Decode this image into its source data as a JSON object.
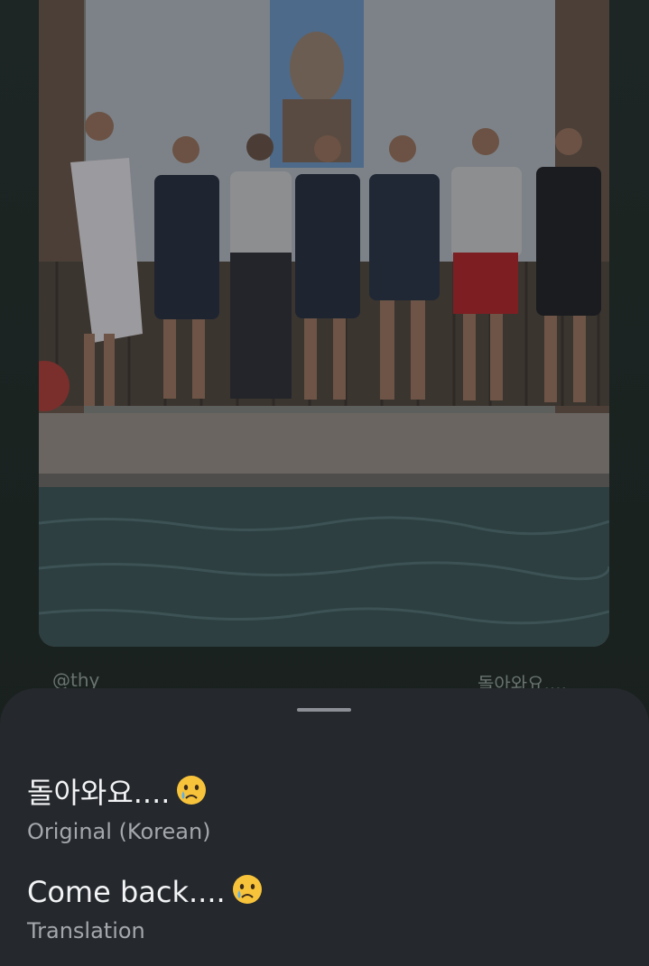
{
  "photo": {
    "description_icon": "photo"
  },
  "caption": {
    "user": "@thy",
    "text": "돌아와요....",
    "emoji": "crying-face-icon"
  },
  "sheet": {
    "original": {
      "text": "돌아와요....",
      "emoji": "crying-face-icon",
      "label": "Original (Korean)"
    },
    "translation": {
      "text": "Come back....",
      "emoji": "crying-face-icon",
      "label": "Translation"
    }
  },
  "colors": {
    "sheet_bg": "#25282c",
    "primary_text": "#f2f3f5",
    "secondary_text": "#a4a8ad",
    "handle": "#8c9096"
  }
}
